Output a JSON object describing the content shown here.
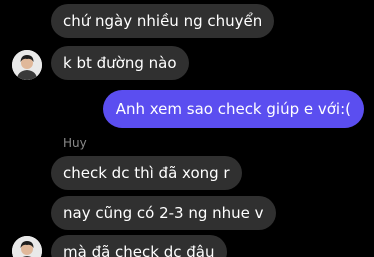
{
  "messages": [
    {
      "text": "chứ ngày nhiều ng chuyển",
      "direction": "incoming"
    },
    {
      "text": "k bt đường nào",
      "direction": "incoming"
    },
    {
      "text": "Anh xem sao check giúp e với:(",
      "direction": "outgoing"
    },
    {
      "text": "check dc thì đã xong r",
      "direction": "incoming"
    },
    {
      "text": "nay cũng có 2-3 ng nhue v",
      "direction": "incoming"
    },
    {
      "text": "mà đã check dc đâu",
      "direction": "incoming"
    }
  ],
  "sender_name": "Huy",
  "colors": {
    "background": "#000000",
    "incoming_bubble": "#303030",
    "outgoing_bubble": "#5b4ef0",
    "text": "#ffffff",
    "sender_label": "#8a8a8a"
  }
}
